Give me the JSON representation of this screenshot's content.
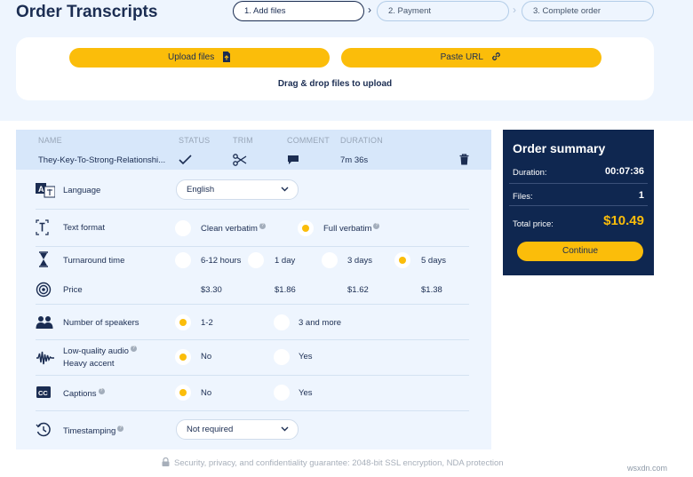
{
  "page": {
    "title": "Order Transcripts",
    "steps": [
      "1. Add files",
      "2. Payment",
      "3. Complete order"
    ]
  },
  "upload": {
    "upload_label": "Upload files",
    "paste_label": "Paste URL",
    "drag_hint": "Drag & drop files to upload"
  },
  "file_table": {
    "columns": [
      "NAME",
      "STATUS",
      "TRIM",
      "COMMENT",
      "DURATION"
    ],
    "file": {
      "name": "They-Key-To-Strong-Relationshi...",
      "duration": "7m 36s"
    }
  },
  "options": {
    "language": {
      "label": "Language",
      "value": "English"
    },
    "text_format": {
      "label": "Text format",
      "options": [
        "Clean verbatim",
        "Full verbatim"
      ],
      "selected": "Full verbatim"
    },
    "turnaround": {
      "label": "Turnaround time",
      "options": [
        "6-12 hours",
        "1 day",
        "3 days",
        "5 days"
      ],
      "selected": "5 days"
    },
    "price": {
      "label": "Price",
      "values": [
        "$3.30",
        "$1.86",
        "$1.62",
        "$1.38"
      ]
    },
    "speakers": {
      "label": "Number of speakers",
      "options": [
        "1-2",
        "3 and more"
      ],
      "selected": "1-2"
    },
    "audio": {
      "label": "Low-quality audio",
      "label2": "Heavy accent",
      "options": [
        "No",
        "Yes"
      ],
      "selected": "No"
    },
    "captions": {
      "label": "Captions",
      "options": [
        "No",
        "Yes"
      ],
      "selected": "No"
    },
    "timestamping": {
      "label": "Timestamping",
      "value": "Not required"
    }
  },
  "summary": {
    "title": "Order summary",
    "duration_label": "Duration:",
    "duration_value": "00:07:36",
    "files_label": "Files:",
    "files_value": "1",
    "total_label": "Total price:",
    "total_value": "$10.49",
    "continue_label": "Continue"
  },
  "footer": {
    "guarantee": "Security, privacy, and confidentiality guarantee: 2048-bit SSL encryption, NDA protection",
    "watermark": "wsxdn.com"
  },
  "colors": {
    "accent": "#fbbd0a",
    "navy": "#0f2750",
    "panel_bg": "#eef5fe"
  },
  "icons": {
    "upload": "document-upload-icon",
    "paste": "link-icon",
    "status": "check-icon",
    "trim": "scissors-icon",
    "comment": "comment-icon",
    "delete": "trash-icon",
    "language": "translate-icon",
    "text_format": "text-format-icon",
    "turnaround": "hourglass-icon",
    "price": "coins-icon",
    "speakers": "people-icon",
    "audio": "waveform-icon",
    "captions": "captions-icon",
    "timestamping": "clock-history-icon",
    "guarantee": "lock-icon"
  }
}
